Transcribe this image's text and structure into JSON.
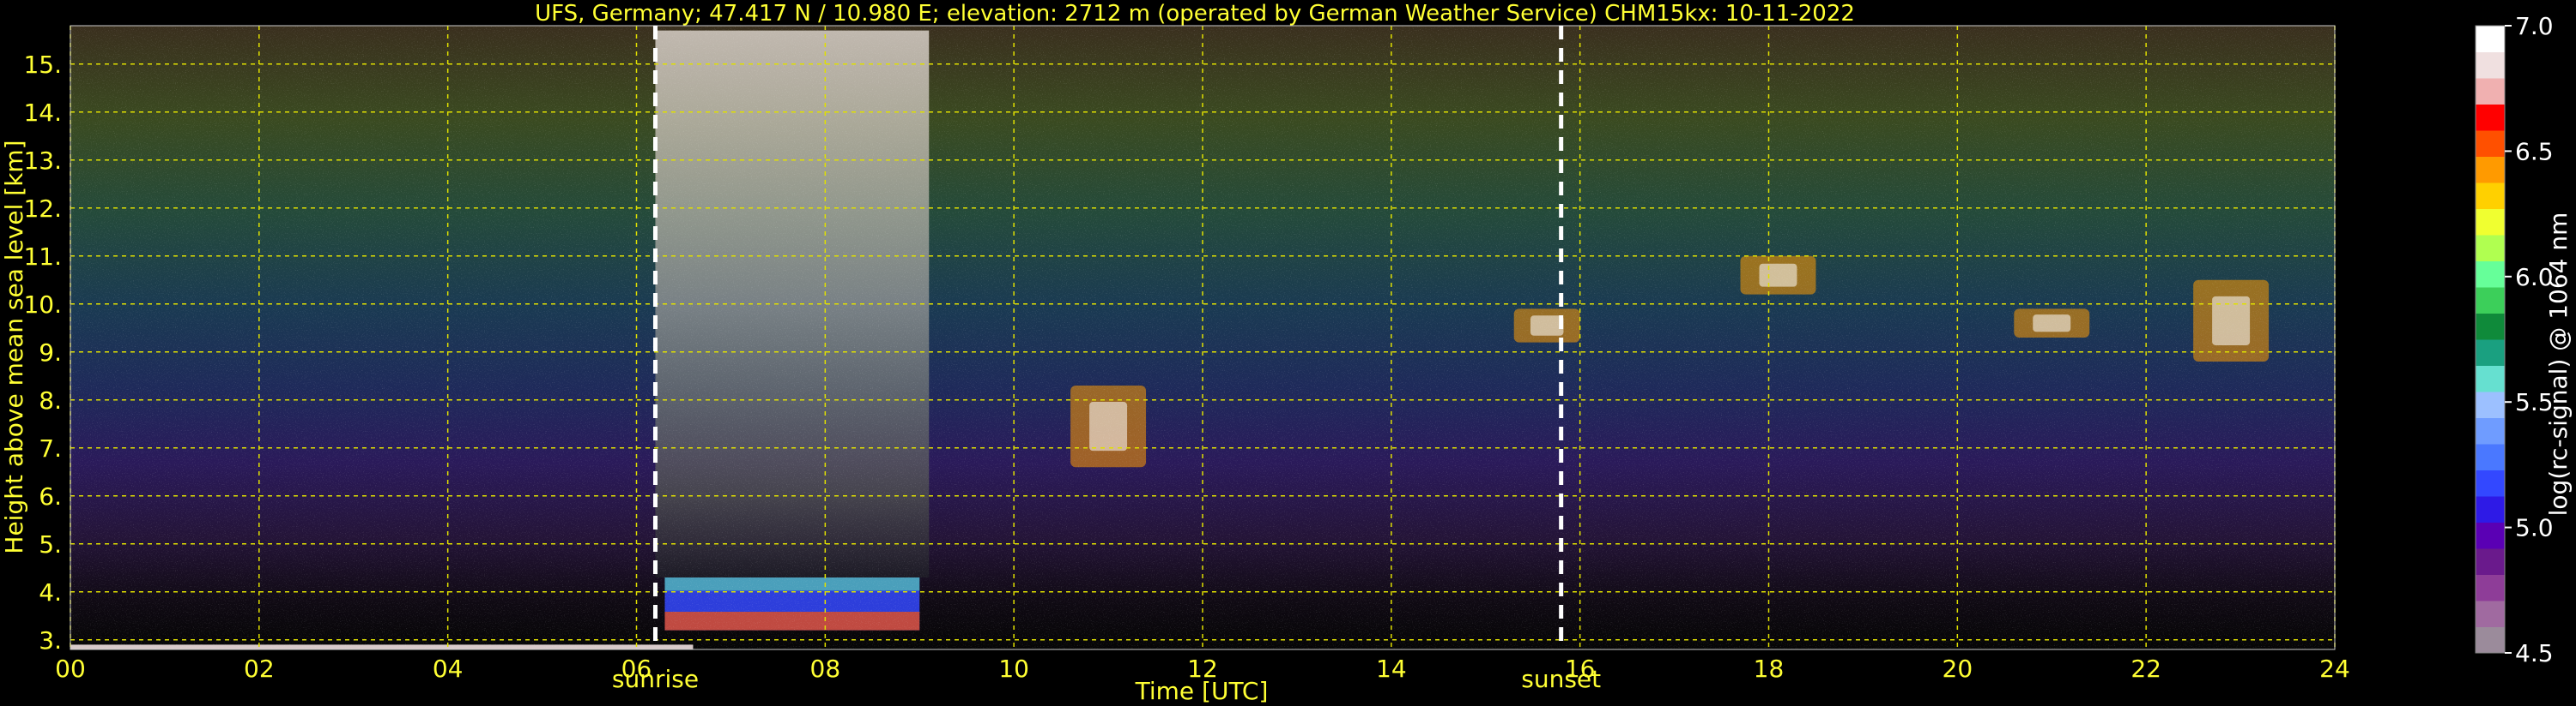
{
  "chart_data": {
    "type": "heatmap",
    "title": "UFS, Germany; 47.417 N / 10.980 E; elevation: 2712 m  (operated by German Weather Service)    CHM15kx: 10-11-2022",
    "xlabel": "Time [UTC]",
    "ylabel": "Height above mean sea level [km]",
    "xlim": [
      0,
      24
    ],
    "ylim": [
      2.8,
      15.8
    ],
    "x_ticks": [
      "00",
      "02",
      "04",
      "06",
      "08",
      "10",
      "12",
      "14",
      "16",
      "18",
      "20",
      "22",
      "24"
    ],
    "y_ticks": [
      "3.",
      "4.",
      "5.",
      "6.",
      "7.",
      "8.",
      "9.",
      "10.",
      "11.",
      "12.",
      "13.",
      "14.",
      "15."
    ],
    "grid": true,
    "markers": [
      {
        "label": "sunrise",
        "x": 6.2
      },
      {
        "label": "sunset",
        "x": 15.8
      }
    ],
    "colorbar": {
      "label": "log(rc-signal) @ 1064 nm",
      "range": [
        4.5,
        7.0
      ],
      "ticks": [
        "4.5",
        "5.0",
        "5.5",
        "6.0",
        "6.5",
        "7.0"
      ]
    },
    "features": [
      {
        "kind": "strong signal near surface",
        "t0": 6.3,
        "t1": 9.0,
        "h0": 3.2,
        "h1": 4.3
      },
      {
        "kind": "high background noise",
        "t0": 6.2,
        "t1": 9.1,
        "h0": 4.3,
        "h1": 15.7
      },
      {
        "kind": "cloud",
        "t0": 10.6,
        "t1": 11.4,
        "h0": 6.6,
        "h1": 8.3
      },
      {
        "kind": "cloud",
        "t0": 15.3,
        "t1": 16.0,
        "h0": 9.2,
        "h1": 9.9
      },
      {
        "kind": "cloud",
        "t0": 17.7,
        "t1": 18.5,
        "h0": 10.2,
        "h1": 11.0
      },
      {
        "kind": "cloud",
        "t0": 20.6,
        "t1": 21.4,
        "h0": 9.3,
        "h1": 9.9
      },
      {
        "kind": "cloud",
        "t0": 22.5,
        "t1": 23.3,
        "h0": 8.8,
        "h1": 10.5
      }
    ]
  },
  "colors": {
    "axis_text": "#ffff33",
    "grid": "#e0e000",
    "marker_line": "#ffffff",
    "colorbar_text": "#ffffff",
    "colormap": [
      "#9b8b9b",
      "#a06aa0",
      "#8e3d98",
      "#6a1a8c",
      "#5a00b4",
      "#2e1ae6",
      "#3348ff",
      "#4a78ff",
      "#6f9cff",
      "#9cc0ff",
      "#66e0d0",
      "#1aa080",
      "#0f8a3a",
      "#3ccf5a",
      "#66ff99",
      "#b0ff50",
      "#f0ff30",
      "#ffd000",
      "#ff9a00",
      "#ff5000",
      "#ff0000",
      "#f0b0b0",
      "#f0e0e0",
      "#ffffff"
    ]
  }
}
